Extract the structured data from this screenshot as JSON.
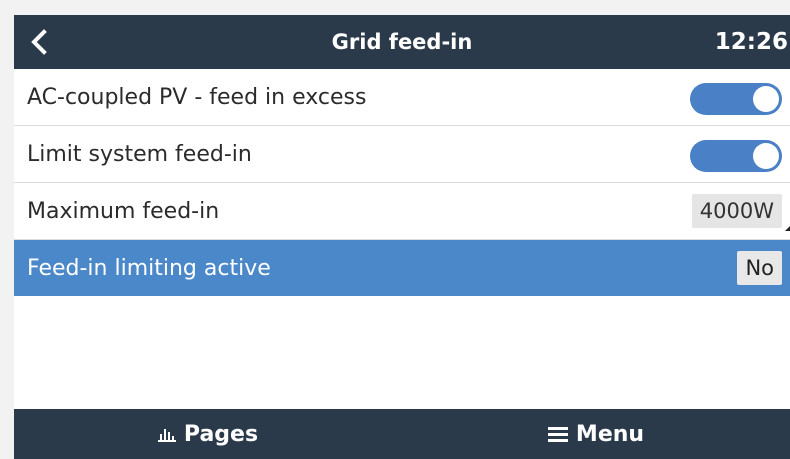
{
  "header": {
    "back_icon": "chevron-left-icon",
    "title": "Grid feed-in",
    "time": "12:26"
  },
  "settings": {
    "ac_coupled_pv": {
      "label": "AC-coupled PV - feed in excess",
      "enabled": true
    },
    "limit_feed_in": {
      "label": "Limit system feed-in",
      "enabled": true
    },
    "max_feed_in": {
      "label": "Maximum feed-in",
      "value": "4000W"
    },
    "limiting_active": {
      "label": "Feed-in limiting active",
      "value": "No"
    }
  },
  "footer": {
    "pages": {
      "label": "Pages",
      "icon": "bar-chart-icon"
    },
    "menu": {
      "label": "Menu",
      "icon": "hamburger-menu-icon"
    }
  },
  "colors": {
    "bar_bg": "#2b3a4a",
    "toggle_on": "#4a80c6",
    "highlight_row": "#4b88c9"
  }
}
